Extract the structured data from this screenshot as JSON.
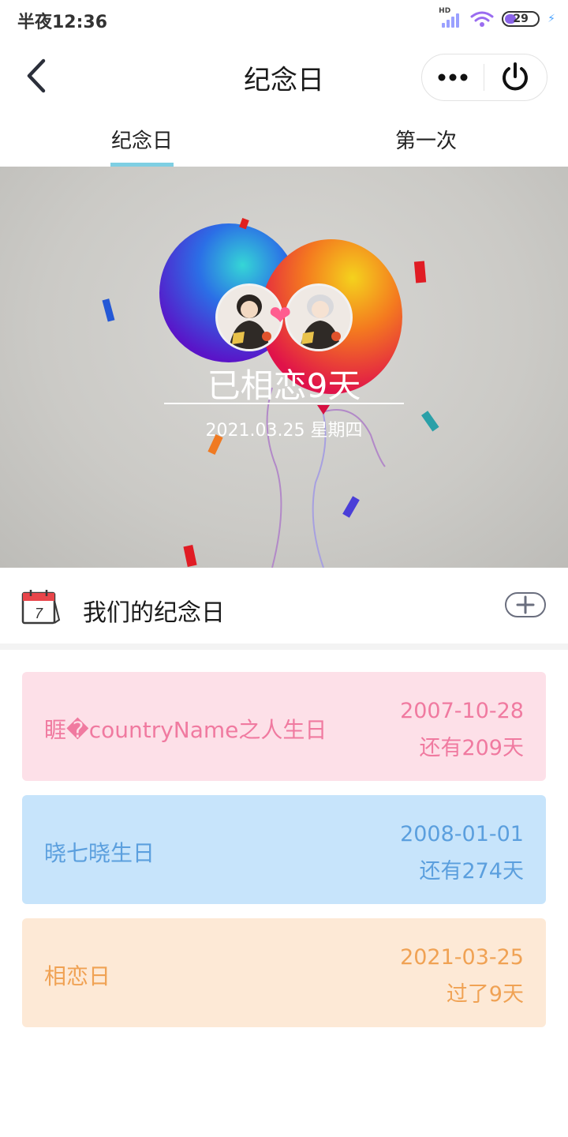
{
  "status_bar": {
    "time": "半夜12:36",
    "hd_label": "HD",
    "battery_level": "29",
    "colors": {
      "signal": "#9aa0ff",
      "wifi": "#9a6cf0",
      "battery_fill": "#8a63e8",
      "charging": "#4aa3ff"
    },
    "icons": [
      "signal-icon",
      "wifi-icon",
      "battery-icon",
      "charging-bolt-icon"
    ]
  },
  "nav": {
    "title": "纪念日",
    "back_icon": "chevron-left-icon",
    "more_icon": "more-dots-icon",
    "power_icon": "power-icon"
  },
  "tabs": {
    "active_index": 0,
    "accent_color": "#7ecfe3",
    "items": [
      {
        "label": "纪念日"
      },
      {
        "label": "第一次"
      }
    ]
  },
  "hero": {
    "title": "已相恋9天",
    "date": "2021.03.25 星期四",
    "heart_icon": "heart-icon"
  },
  "section": {
    "title": "我们的纪念日",
    "calendar_day": "7",
    "calendar_icon": "calendar-icon",
    "add_icon": "plus-icon"
  },
  "anniversaries": [
    {
      "name": "睚�countryName之人生日",
      "date": "2007-10-28",
      "count": "还有209天",
      "bg": "#fde0e8",
      "text_color": "#f07aa0"
    },
    {
      "name": "晓七晓生日",
      "date": "2008-01-01",
      "count": "还有274天",
      "bg": "#c7e4fb",
      "text_color": "#5b9fde"
    },
    {
      "name": "相恋日",
      "date": "2021-03-25",
      "count": "过了9天",
      "bg": "#fde9d6",
      "text_color": "#f0a254"
    }
  ]
}
